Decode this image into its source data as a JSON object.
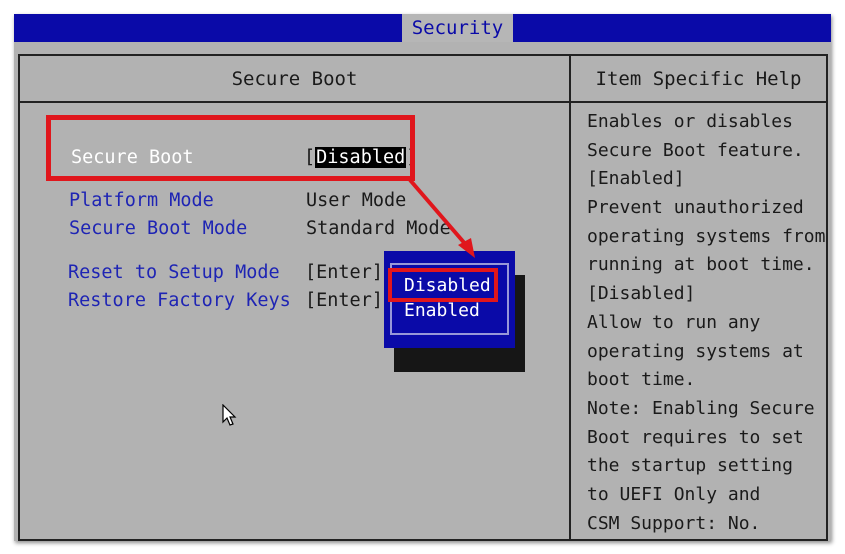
{
  "topbar": {
    "tab_label": "Security"
  },
  "left_panel": {
    "header": "Secure Boot",
    "items": [
      {
        "label": "Secure Boot",
        "value_open": "[",
        "value": "Disabled",
        "value_close": "]"
      },
      {
        "label": "Platform Mode",
        "value": "User Mode"
      },
      {
        "label": "Secure Boot Mode",
        "value": "Standard Mode"
      },
      {
        "label": "Reset to Setup Mode",
        "value": "[Enter]"
      },
      {
        "label": "Restore Factory Keys",
        "value": "[Enter]"
      }
    ]
  },
  "help_panel": {
    "header": "Item Specific Help",
    "lines": [
      "Enables or disables",
      "Secure Boot feature.",
      "[Enabled]",
      "Prevent unauthorized",
      "operating systems from",
      "running at boot time.",
      "[Disabled]",
      "Allow to run any",
      "operating systems at",
      "boot time.",
      "Note: Enabling Secure",
      "Boot requires to set",
      "the startup setting",
      "to UEFI Only and",
      "CSM Support: No."
    ]
  },
  "popup": {
    "options": [
      "Disabled",
      "Enabled"
    ],
    "selected": "Disabled"
  },
  "colors": {
    "bios_blue": "#0a0aa8",
    "panel_gray": "#b2b2b2",
    "label_blue": "#1e24b4",
    "annotation_red": "#e0161c"
  },
  "icons": {
    "cursor": "mouse-pointer-icon",
    "annotation_arrow": "arrow-icon"
  }
}
